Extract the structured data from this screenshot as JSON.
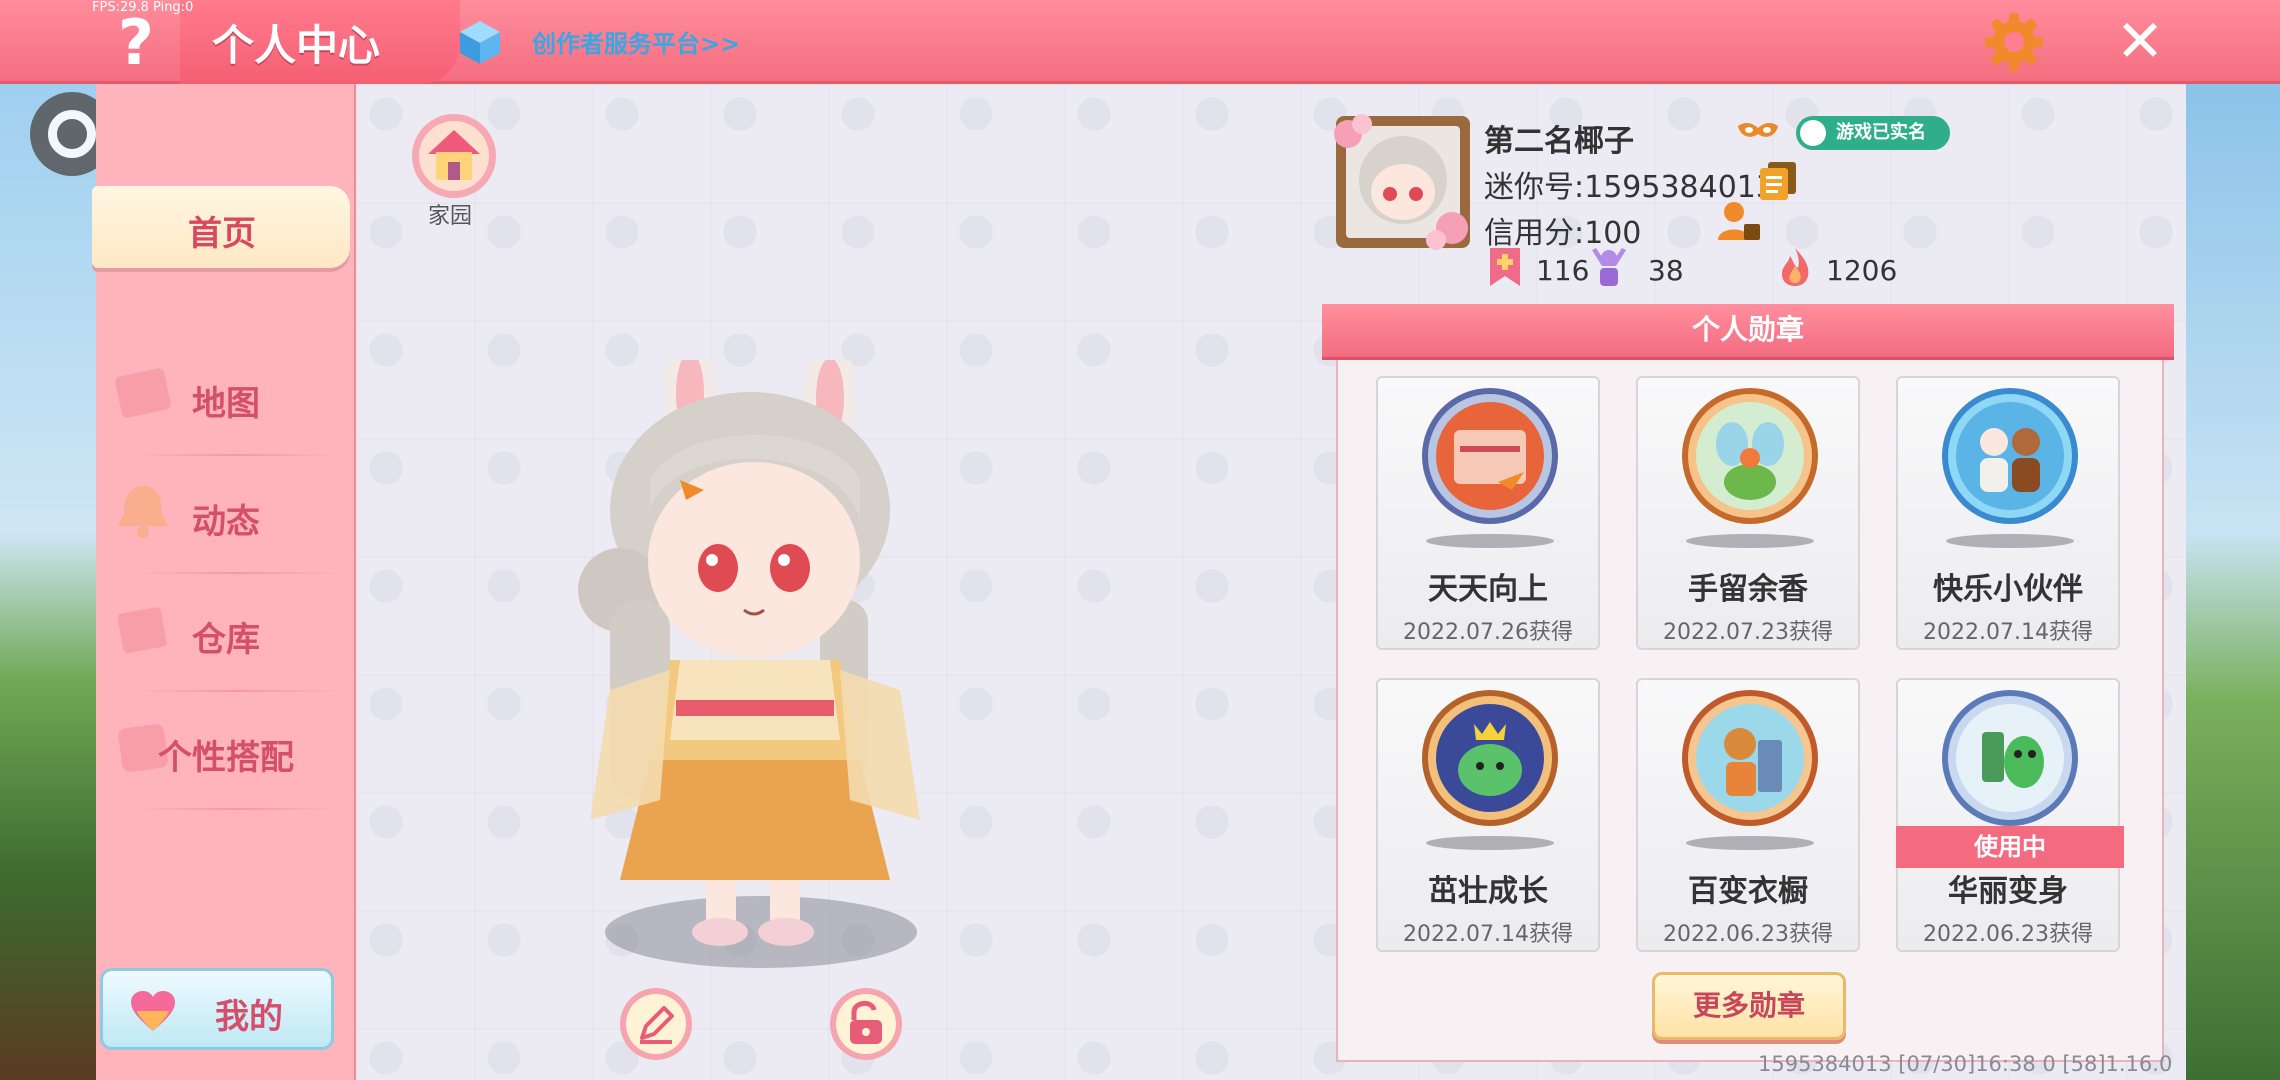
{
  "debug": {
    "fps": "FPS:29.8  Ping:0"
  },
  "header": {
    "title": "个人中心",
    "creator_link": "创作者服务平台>>",
    "help_label": "?",
    "close_label": "✕"
  },
  "sidebar": {
    "items": [
      {
        "label": "首页",
        "active": true
      },
      {
        "label": "地图"
      },
      {
        "label": "动态"
      },
      {
        "label": "仓库"
      },
      {
        "label": "个性搭配"
      }
    ],
    "my_button": "我的"
  },
  "main": {
    "home_label": "家园"
  },
  "profile": {
    "nickname": "第二名椰子",
    "realname_badge": "游戏已实名",
    "mini_id": "迷你号:1595384013",
    "credit": "信用分:100",
    "stats": [
      {
        "icon": "bookmark-plus-icon",
        "value": "116"
      },
      {
        "icon": "cheer-icon",
        "value": "38"
      },
      {
        "icon": "flame-icon",
        "value": "1206"
      }
    ]
  },
  "badges": {
    "title": "个人勋章",
    "items": [
      {
        "name": "天天向上",
        "date": "2022.07.26获得",
        "color": "#e8643a"
      },
      {
        "name": "手留余香",
        "date": "2022.07.23获得",
        "color": "#c9e4c0"
      },
      {
        "name": "快乐小伙伴",
        "date": "2022.07.14获得",
        "color": "#6ec3ea"
      },
      {
        "name": "茁壮成长",
        "date": "2022.07.14获得",
        "color": "#4a5aa8"
      },
      {
        "name": "百变衣橱",
        "date": "2022.06.23获得",
        "color": "#8fd2e8"
      },
      {
        "name": "华丽变身",
        "date": "2022.06.23获得",
        "color": "#d8ecf6",
        "in_use": "使用中"
      }
    ],
    "more_button": "更多勋章"
  },
  "footer": {
    "info": "1595384013   [07/30]16:38 0   [58]1.16.0"
  }
}
